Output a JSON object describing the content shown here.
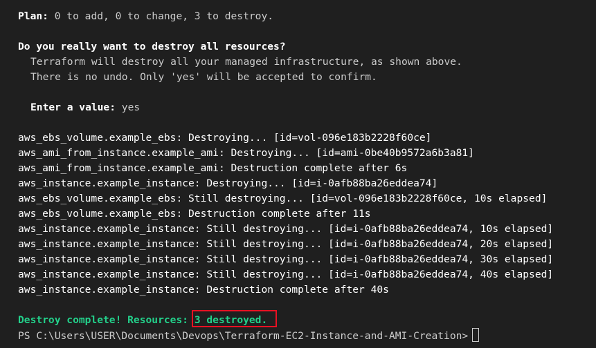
{
  "plan": {
    "label": "Plan:",
    "text": " 0 to add, 0 to change, 3 to destroy."
  },
  "question": {
    "title": "Do you really want to destroy all resources?",
    "line1": "Terraform will destroy all your managed infrastructure, as shown above.",
    "line2": "There is no undo. Only 'yes' will be accepted to confirm."
  },
  "prompt": {
    "label": "Enter a value:",
    "value": " yes"
  },
  "log": [
    "aws_ebs_volume.example_ebs: Destroying... [id=vol-096e183b2228f60ce]",
    "aws_ami_from_instance.example_ami: Destroying... [id=ami-0be40b9572a6b3a81]",
    "aws_ami_from_instance.example_ami: Destruction complete after 6s",
    "aws_instance.example_instance: Destroying... [id=i-0afb88ba26eddea74]",
    "aws_ebs_volume.example_ebs: Still destroying... [id=vol-096e183b2228f60ce, 10s elapsed]",
    "aws_ebs_volume.example_ebs: Destruction complete after 11s",
    "aws_instance.example_instance: Still destroying... [id=i-0afb88ba26eddea74, 10s elapsed]",
    "aws_instance.example_instance: Still destroying... [id=i-0afb88ba26eddea74, 20s elapsed]",
    "aws_instance.example_instance: Still destroying... [id=i-0afb88ba26eddea74, 30s elapsed]",
    "aws_instance.example_instance: Still destroying... [id=i-0afb88ba26eddea74, 40s elapsed]",
    "aws_instance.example_instance: Destruction complete after 40s"
  ],
  "result": {
    "prefix": "Destroy complete! Resources: ",
    "count": "3 destroyed."
  },
  "shell_prompt": "PS C:\\Users\\USER\\Documents\\Devops\\Terraform-EC2-Instance-and-AMI-Creation>",
  "colors": {
    "background": "#1f1f1f",
    "success": "#23d18b",
    "highlight_border": "#e81123"
  }
}
